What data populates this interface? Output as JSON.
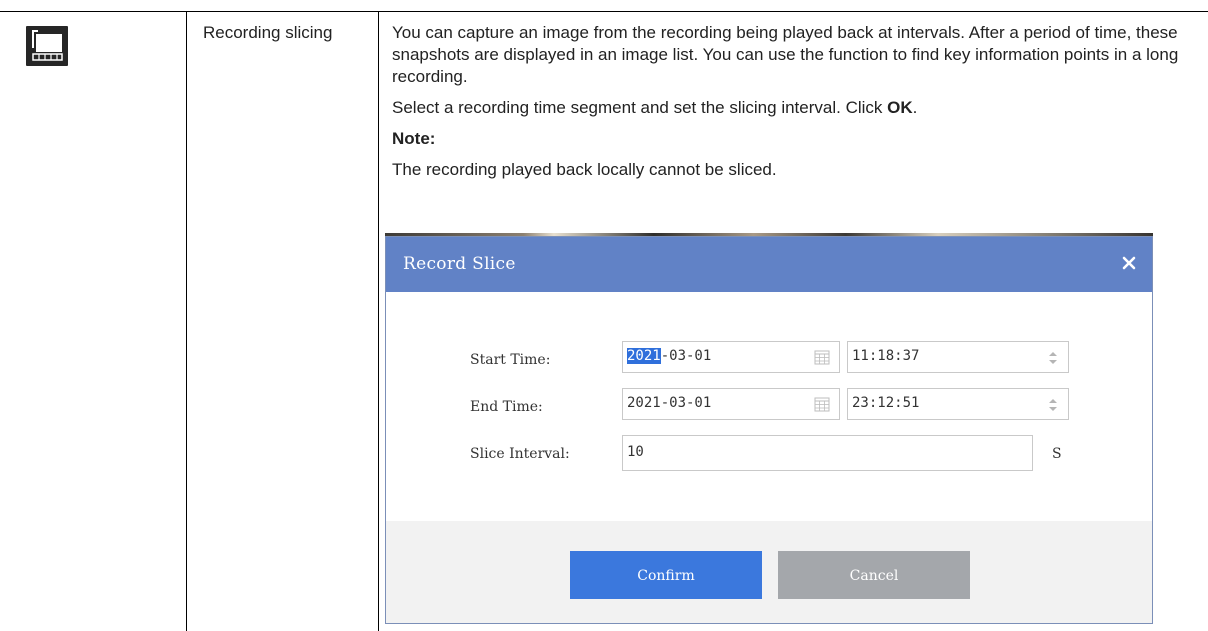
{
  "row": {
    "function_name": "Recording slicing",
    "icon": "recording-slicing-icon",
    "description": {
      "paragraph1": "You can capture an image from the recording being played back at intervals. After a period of time, these snapshots are displayed in an image list. You can use the function to find key information points in a long recording.",
      "paragraph2_before": "Select a recording time segment and set the slicing interval. Click ",
      "paragraph2_bold": "OK",
      "paragraph2_after": ".",
      "note_label": "Note:",
      "note_text": "The recording played back locally cannot be sliced."
    }
  },
  "dialog": {
    "title": "Record Slice",
    "start_time_label": "Start Time:",
    "start_date_year": "2021",
    "start_date_rest": "-03-01",
    "start_time_value": "11:18:37",
    "end_time_label": "End Time:",
    "end_date_value": "2021-03-01",
    "end_time_value": "23:12:51",
    "slice_interval_label": "Slice Interval:",
    "slice_interval_value": "10",
    "slice_interval_unit": "S",
    "confirm_label": "Confirm",
    "cancel_label": "Cancel"
  },
  "colors": {
    "titlebar": "#6182c6",
    "confirm_button": "#3b78dd",
    "cancel_button": "#a4a7ab",
    "footer": "#f2f2f2",
    "selection": "#2f6fdb"
  }
}
